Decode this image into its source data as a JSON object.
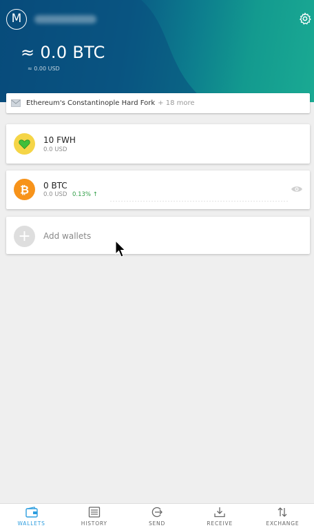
{
  "header": {
    "avatar_letter": "M",
    "account_name": "",
    "balance": "≈ 0.0 BTC",
    "balance_fiat": "≈ 0.00 USD"
  },
  "news": {
    "title": "Ethereum's Constantinople Hard Fork",
    "more": "+ 18 more"
  },
  "wallets": [
    {
      "amount": "10 FWH",
      "fiat": "0.0 USD",
      "icon": "heart-coin-icon",
      "color": "#f5d547"
    },
    {
      "amount": "0 BTC",
      "fiat": "0.0 USD",
      "change": "0.13% ↑",
      "icon": "bitcoin-icon",
      "color": "#f7931a",
      "change_color": "#2e9d45"
    }
  ],
  "add_wallets_label": "Add wallets",
  "tabs": [
    {
      "label": "WALLETS",
      "icon": "wallet-icon",
      "active": true
    },
    {
      "label": "HISTORY",
      "icon": "history-icon",
      "active": false
    },
    {
      "label": "SEND",
      "icon": "send-icon",
      "active": false
    },
    {
      "label": "RECEIVE",
      "icon": "receive-icon",
      "active": false
    },
    {
      "label": "EXCHANGE",
      "icon": "exchange-icon",
      "active": false
    }
  ],
  "colors": {
    "accent": "#2c9ddf",
    "header_start": "#064878",
    "header_end": "#1aaa93"
  }
}
